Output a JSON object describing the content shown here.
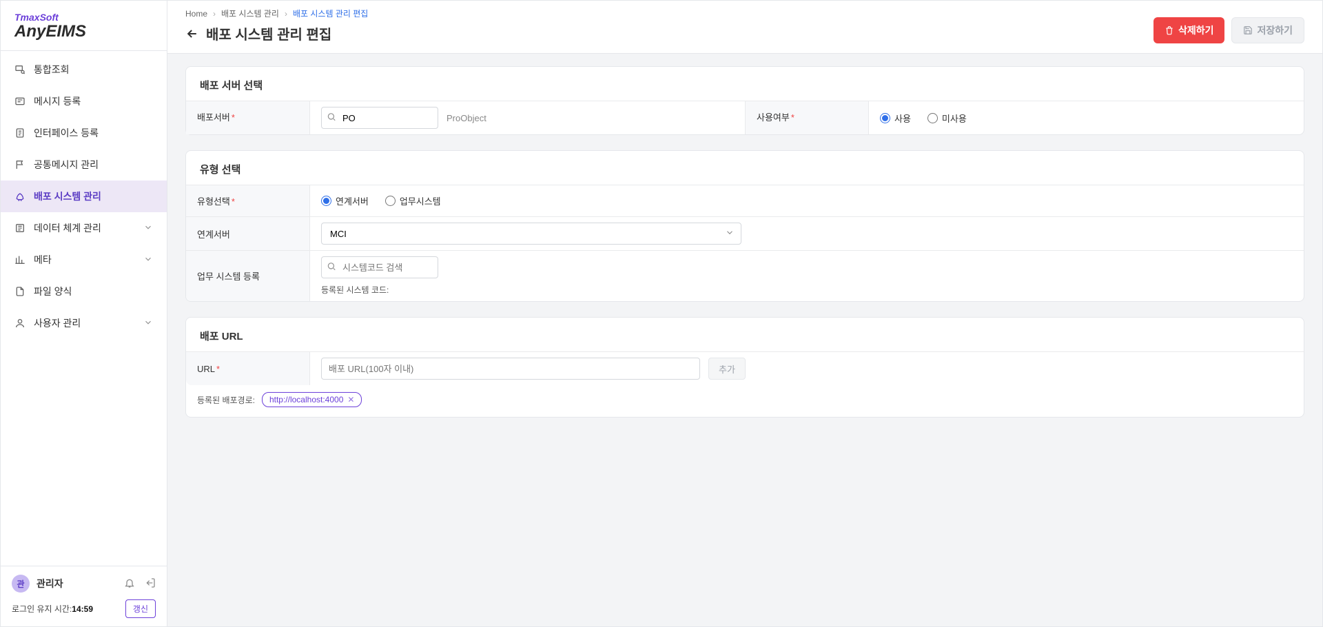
{
  "logo": {
    "brand": "TmaxSoft",
    "product": "AnyEIMS"
  },
  "nav": [
    {
      "label": "통합조회",
      "expandable": false
    },
    {
      "label": "메시지 등록",
      "expandable": false
    },
    {
      "label": "인터페이스 등록",
      "expandable": false
    },
    {
      "label": "공통메시지 관리",
      "expandable": false
    },
    {
      "label": "배포 시스템 관리",
      "expandable": false,
      "active": true
    },
    {
      "label": "데이터 체계 관리",
      "expandable": true
    },
    {
      "label": "메타",
      "expandable": true
    },
    {
      "label": "파일 양식",
      "expandable": false
    },
    {
      "label": "사용자 관리",
      "expandable": true
    }
  ],
  "user": {
    "avatar_letter": "관",
    "name": "관리자"
  },
  "session": {
    "label": "로그인 유지 시간:",
    "time": "14:59",
    "refresh_label": "갱신"
  },
  "breadcrumb": [
    {
      "label": "Home"
    },
    {
      "label": "배포 시스템 관리"
    },
    {
      "label": "배포 시스템 관리 편집",
      "active": true
    }
  ],
  "page_title": "배포 시스템 관리 편집",
  "actions": {
    "delete": "삭제하기",
    "save": "저장하기"
  },
  "section_server": {
    "title": "배포 서버 선택",
    "server_label": "배포서버",
    "server_value": "PO",
    "server_detail": "ProObject",
    "usage_label": "사용여부",
    "usage_options": {
      "on": "사용",
      "off": "미사용"
    }
  },
  "section_type": {
    "title": "유형 선택",
    "type_label": "유형선택",
    "type_options": {
      "linked": "연계서버",
      "biz": "업무시스템"
    },
    "linked_label": "연계서버",
    "linked_value": "MCI",
    "biz_reg_label": "업무 시스템 등록",
    "biz_search_placeholder": "시스템코드 검색",
    "biz_registered_label": "등록된 시스템 코드:"
  },
  "section_url": {
    "title": "배포 URL",
    "url_label": "URL",
    "url_placeholder": "배포 URL(100자 이내)",
    "add_label": "추가",
    "path_label": "등록된 배포경로:",
    "path_value": "http://localhost:4000"
  }
}
